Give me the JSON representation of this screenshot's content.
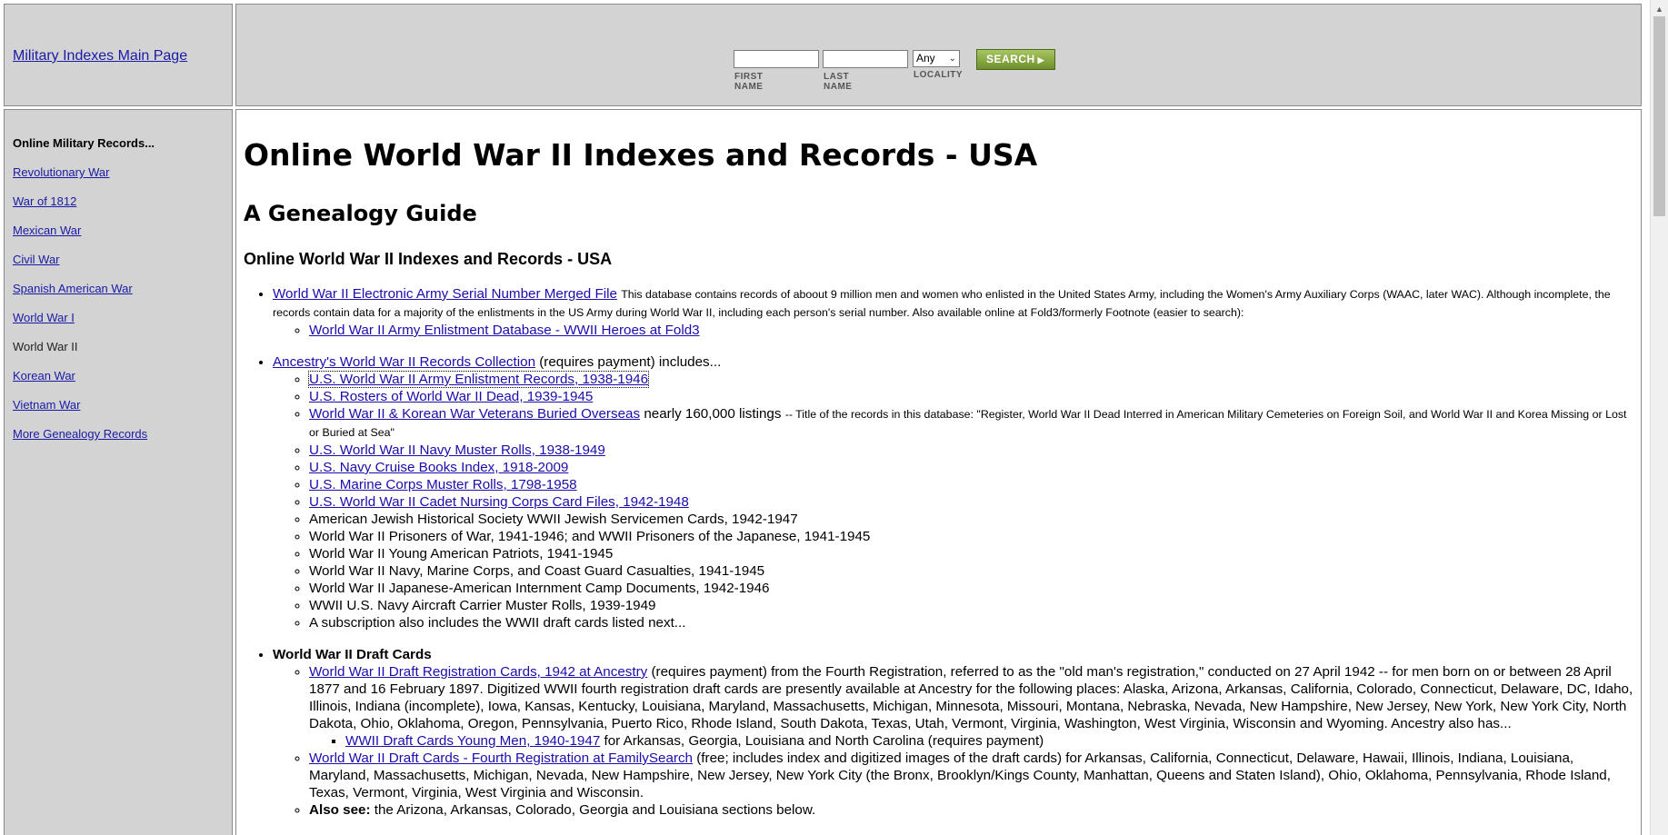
{
  "header": {
    "main_link": "Military Indexes Main Page"
  },
  "search": {
    "first_name_label": "FIRST NAME",
    "last_name_label": "LAST NAME",
    "locality_label": "LOCALITY",
    "locality_value": "Any",
    "button_label": "SEARCH"
  },
  "sidebar": {
    "title": "Online Military Records...",
    "items": [
      {
        "label": "Revolutionary War"
      },
      {
        "label": "War of 1812"
      },
      {
        "label": "Mexican War"
      },
      {
        "label": "Civil War"
      },
      {
        "label": "Spanish American War"
      },
      {
        "label": "World War I"
      },
      {
        "label": "World War II"
      },
      {
        "label": "Korean War"
      },
      {
        "label": "Vietnam War"
      },
      {
        "label": "More Genealogy Records"
      }
    ]
  },
  "main": {
    "title": "Online World War II Indexes and Records - USA",
    "subtitle": "A Genealogy Guide",
    "heading": "Online World War II Indexes and Records - USA",
    "s1": {
      "link": "World War II Electronic Army Serial Number Merged File",
      "desc": "This database contains records of aboout 9 million men and women who enlisted in the United States Army, including the Women's Army Auxiliary Corps (WAAC, later WAC). Although incomplete, the records contain data for a majority of the enlistments in the US Army during World War II, including each person's serial number. Also available online at Fold3/formerly Footnote (easier to search):",
      "sub_link": "World War II Army Enlistment Database - WWII Heroes at Fold3"
    },
    "s2": {
      "link": "Ancestry's World War II Records Collection",
      "after": "(requires payment) includes...",
      "links": [
        "U.S. World War II Army Enlistment Records, 1938-1946",
        "U.S. Rosters of World War II Dead, 1939-1945",
        "World War II & Korean War Veterans Buried Overseas"
      ],
      "listings": "nearly 160,000 listings",
      "listings_desc": "-- Title of the records in this database: \"Register, World War II Dead Interred in American Military Cemeteries on Foreign Soil, and World War II and Korea Missing or Lost or Buried at Sea\"",
      "links2": [
        "U.S. World War II Navy Muster Rolls, 1938-1949",
        "U.S. Navy Cruise Books Index, 1918-2009",
        "U.S. Marine Corps Muster Rolls, 1798-1958",
        "U.S. World War II Cadet Nursing Corps Card Files, 1942-1948"
      ],
      "plain": [
        "American Jewish Historical Society WWII Jewish Servicemen Cards, 1942-1947",
        "World War II Prisoners of War, 1941-1946; and WWII Prisoners of the Japanese, 1941-1945",
        "World War II Young American Patriots, 1941-1945",
        "World War II Navy, Marine Corps, and Coast Guard Casualties, 1941-1945",
        "World War II Japanese-American Internment Camp Documents, 1942-1946",
        "WWII U.S. Navy Aircraft Carrier Muster Rolls, 1939-1949",
        "A subscription also includes the WWII draft cards listed next..."
      ]
    },
    "s3": {
      "title": "World War II Draft Cards",
      "a_link": "World War II Draft Registration Cards, 1942 at Ancestry",
      "a_text": "(requires payment) from the Fourth Registration, referred to as the \"old man's registration,\" conducted on 27 April 1942 -- for men born on or between 28 April 1877 and 16 February 1897. Digitized WWII fourth registration draft cards are presently available at Ancestry for the following places: Alaska, Arizona, Arkansas, California, Colorado, Connecticut, Delaware, DC, Idaho, Illinois, Indiana (incomplete), Iowa, Kansas, Kentucky, Louisiana, Maryland, Massachusetts, Michigan, Minnesota, Missouri, Montana, Nebraska, Nevada, New Hampshire, New Jersey, New York, New York City, North Dakota, Ohio, Oklahoma, Oregon, Pennsylvania, Puerto Rico, Rhode Island, South Dakota, Texas, Utah, Vermont, Virginia, Washington, West Virginia, Wisconsin and Wyoming. Ancestry also has...",
      "young_link": "WWII Draft Cards Young Men, 1940-1947",
      "young_text": "for Arkansas, Georgia, Louisiana and North Carolina (requires payment)",
      "fs_link": "World War II Draft Cards - Fourth Registration at FamilySearch",
      "fs_text": "(free; includes index and digitized images of the draft cards) for Arkansas, California, Connecticut, Delaware, Hawaii, Illinois, Indiana, Louisiana, Maryland, Massachusetts, Michigan, Nevada, New Hampshire, New Jersey, New York City (the Bronx, Brooklyn/Kings County, Manhattan, Queens and Staten Island), Ohio, Oklahoma, Pennsylvania, Rhode Island, Texas, Vermont, Virginia, West Virginia and Wisconsin.",
      "also_label": "Also see:",
      "also_text": "the Arizona, Arkansas, Colorado, Georgia and Louisiana sections below."
    }
  }
}
